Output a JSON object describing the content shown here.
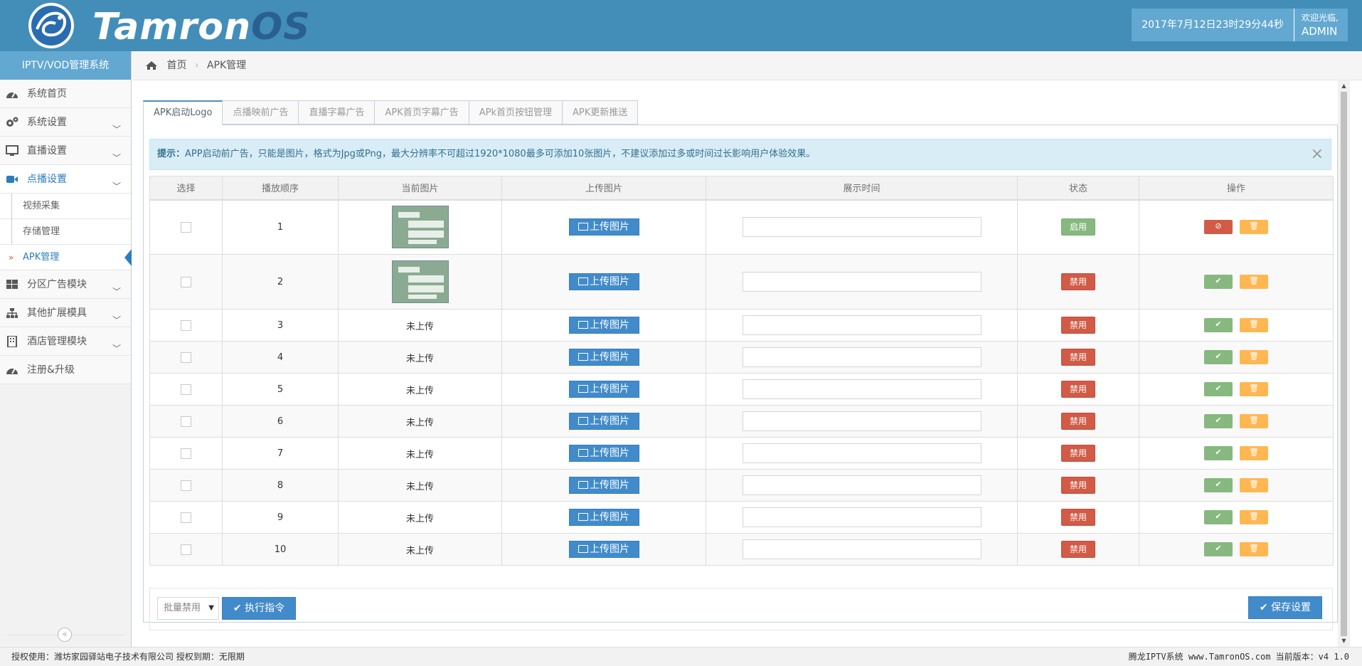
{
  "header": {
    "logo_text_main": "Tamron",
    "logo_text_os": "OS",
    "datetime": "2017年7月12日23时29分44秒",
    "welcome": "欢迎光临,",
    "username": "ADMIN"
  },
  "sidebar": {
    "title": "IPTV/VOD管理系统",
    "items": [
      {
        "label": "系统首页",
        "icon": "dashboard-icon"
      },
      {
        "label": "系统设置",
        "icon": "gears-icon"
      },
      {
        "label": "直播设置",
        "icon": "desktop-icon"
      },
      {
        "label": "点播设置",
        "icon": "video-camera-icon"
      },
      {
        "label": "分区广告模块",
        "icon": "windows-icon"
      },
      {
        "label": "其他扩展模具",
        "icon": "sitemap-icon"
      },
      {
        "label": "酒店管理模块",
        "icon": "building-icon"
      },
      {
        "label": "注册&升级",
        "icon": "dashboard-icon"
      }
    ],
    "sub_items": [
      {
        "label": "视频采集"
      },
      {
        "label": "存储管理"
      },
      {
        "label": "APK管理"
      }
    ],
    "collapse_label": "«"
  },
  "breadcrumb": {
    "home": "首页",
    "separator": "›",
    "current": "APK管理"
  },
  "tabs": [
    {
      "label": "APK启动Logo"
    },
    {
      "label": "点播映前广告"
    },
    {
      "label": "直播字幕广告"
    },
    {
      "label": "APK首页字幕广告"
    },
    {
      "label": "APk首页按钮管理"
    },
    {
      "label": "APK更新推送"
    }
  ],
  "alert": {
    "prefix": "提示：",
    "text": "APP启动前广告，只能是图片，格式为Jpg或Png，最大分辨率不可超过1920*1080最多可添加10张图片，不建议添加过多或时间过长影响用户体验效果。",
    "close": "×"
  },
  "table": {
    "columns": [
      "选择",
      "播放顺序",
      "当前图片",
      "上传图片",
      "展示时间",
      "状态",
      "操作"
    ],
    "upload_label": "上传图片",
    "not_uploaded": "未上传",
    "enabled_label": "启用",
    "disabled_label": "禁用",
    "ban_icon": "⊘",
    "ok_icon": "✔",
    "delete_icon": "🗑",
    "rows": [
      {
        "order": "1",
        "has_image": true,
        "status": "启用",
        "display_time": ""
      },
      {
        "order": "2",
        "has_image": true,
        "status": "禁用",
        "display_time": ""
      },
      {
        "order": "3",
        "has_image": false,
        "image_text": "未上传",
        "status": "禁用",
        "display_time": ""
      },
      {
        "order": "4",
        "has_image": false,
        "image_text": "未上传",
        "status": "禁用",
        "display_time": ""
      },
      {
        "order": "5",
        "has_image": false,
        "image_text": "未上传",
        "status": "禁用",
        "display_time": ""
      },
      {
        "order": "6",
        "has_image": false,
        "image_text": "未上传",
        "status": "禁用",
        "display_time": ""
      },
      {
        "order": "7",
        "has_image": false,
        "image_text": "未上传",
        "status": "禁用",
        "display_time": ""
      },
      {
        "order": "8",
        "has_image": false,
        "image_text": "未上传",
        "status": "禁用",
        "display_time": ""
      },
      {
        "order": "9",
        "has_image": false,
        "image_text": "未上传",
        "status": "禁用",
        "display_time": ""
      },
      {
        "order": "10",
        "has_image": false,
        "image_text": "未上传",
        "status": "禁用",
        "display_time": ""
      }
    ]
  },
  "actions": {
    "batch_select_value": "批量禁用",
    "execute_label": "执行指令",
    "save_label": "保存设置"
  },
  "statusbar": {
    "left": "授权使用：潍坊家园驿站电子技术有限公司 授权到期：无限期",
    "right": "腾龙IPTV系统 www.TamronOS.com 当前版本：v4 1.0"
  },
  "colors": {
    "header": "#438eb9",
    "accent": "#62a8d1",
    "primary_button": "#428bca",
    "success": "#87b87f",
    "danger": "#d15b47",
    "warning": "#ffb752"
  }
}
